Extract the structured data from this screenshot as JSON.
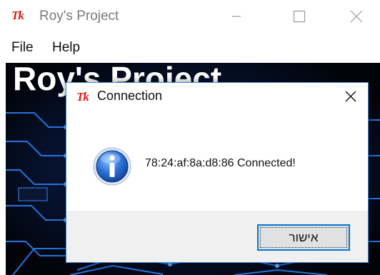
{
  "window": {
    "title": "Roy's Project",
    "logo": "Tk",
    "controls": [
      "minimize-icon",
      "maximize-icon",
      "close-icon"
    ]
  },
  "menubar": {
    "items": [
      {
        "label": "File"
      },
      {
        "label": "Help"
      }
    ]
  },
  "banner": {
    "title": "Roy's Project"
  },
  "dialog": {
    "title": "Connection",
    "logo": "Tk",
    "icon": "info-icon",
    "message": "78:24:af:8a:d8:86 Connected!",
    "ok_label": "אישור"
  },
  "colors": {
    "logo_red": "#e01b1b",
    "dialog_border": "#3f8fd8",
    "button_focus": "#0078d7",
    "circuit_blue": "#1f6fe0"
  }
}
